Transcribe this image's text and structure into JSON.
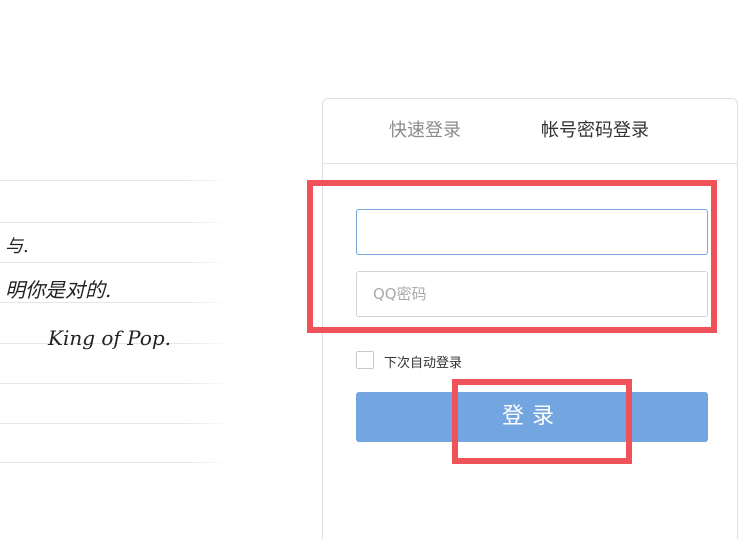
{
  "notebook": {
    "lines": [
      "与.",
      "明你是对的.",
      "King of Pop."
    ]
  },
  "login": {
    "tabs": [
      {
        "label": "快速登录",
        "active": false
      },
      {
        "label": "帐号密码登录",
        "active": true
      }
    ],
    "username": {
      "value": "",
      "placeholder": ""
    },
    "password": {
      "value": "",
      "placeholder": "QQ密码"
    },
    "remember_label": "下次自动登录",
    "remember_checked": false,
    "submit_label": "登录"
  },
  "colors": {
    "accent": "#73a6e0",
    "highlight": "#f0525a",
    "active_input_border": "#7aa7da"
  }
}
